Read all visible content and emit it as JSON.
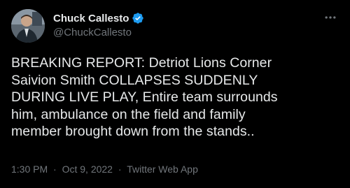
{
  "author": {
    "display_name": "Chuck Callesto",
    "handle": "@ChuckCallesto",
    "verified": true,
    "avatar_icon": "person-photo-avatar"
  },
  "tweet": {
    "lines": [
      "BREAKING REPORT: Detriot Lions Corner",
      "Saivion Smith COLLAPSES SUDDENLY",
      "DURING LIVE PLAY, Entire team surrounds",
      "him, ambulance on the field and family",
      "member brought down from the stands.."
    ]
  },
  "meta": {
    "time": "1:30 PM",
    "separator1": "·",
    "date": "Oct 9, 2022",
    "separator2": "·",
    "source": "Twitter Web App"
  },
  "colors": {
    "background": "#000000",
    "text": "#e7e9ea",
    "secondary": "#71767b",
    "verified": "#1d9bf0"
  },
  "icons": {
    "verified": "verified-badge-icon",
    "more": "more-options-icon"
  }
}
